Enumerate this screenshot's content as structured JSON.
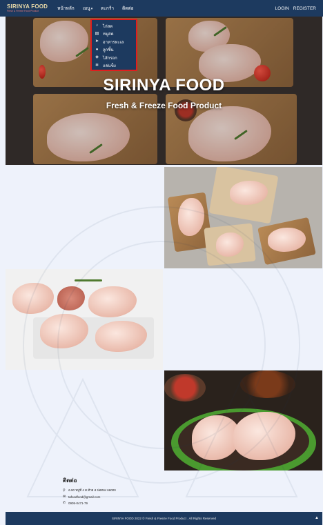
{
  "navbar": {
    "brand": "SIRINYA FOOD",
    "brand_sub": "Fresh & Freeze Food Product",
    "links": [
      "หน้าหลัก",
      "เมนู",
      "ตะกร้า",
      "ติดต่อ"
    ],
    "login": "LOGIN",
    "register": "REGISTER"
  },
  "dropdown": {
    "items": [
      {
        "label": "ไก่สด",
        "icon": "drumstick-icon"
      },
      {
        "label": "หมูสด",
        "icon": "box-icon"
      },
      {
        "label": "อาหารทะเล",
        "icon": "fish-icon"
      },
      {
        "label": "ลูกชิ้น",
        "icon": "ball-icon"
      },
      {
        "label": "ไส้กรอก",
        "icon": "sausage-icon"
      },
      {
        "label": "แช่แข็ง",
        "icon": "snowflake-icon"
      }
    ]
  },
  "hero": {
    "title": "SIRINYA FOOD",
    "subtitle": "Fresh & Freeze Food Product"
  },
  "footer": {
    "title": "ติดต่อ",
    "address": "อ.90 หมู่ที่ 4 ต.ห้วย อ.บ่อทอง 66000",
    "email": "tafoodfood@gmail.com",
    "phone": "0905-0471-79",
    "copyright": "SIRINYA FOOD 2022 © Fresh & Freeze Food Product . All Rights Reserved"
  },
  "colors": {
    "navbar": "#1d3a5f",
    "highlight": "#e01e1e",
    "background": "#eef2fb"
  }
}
